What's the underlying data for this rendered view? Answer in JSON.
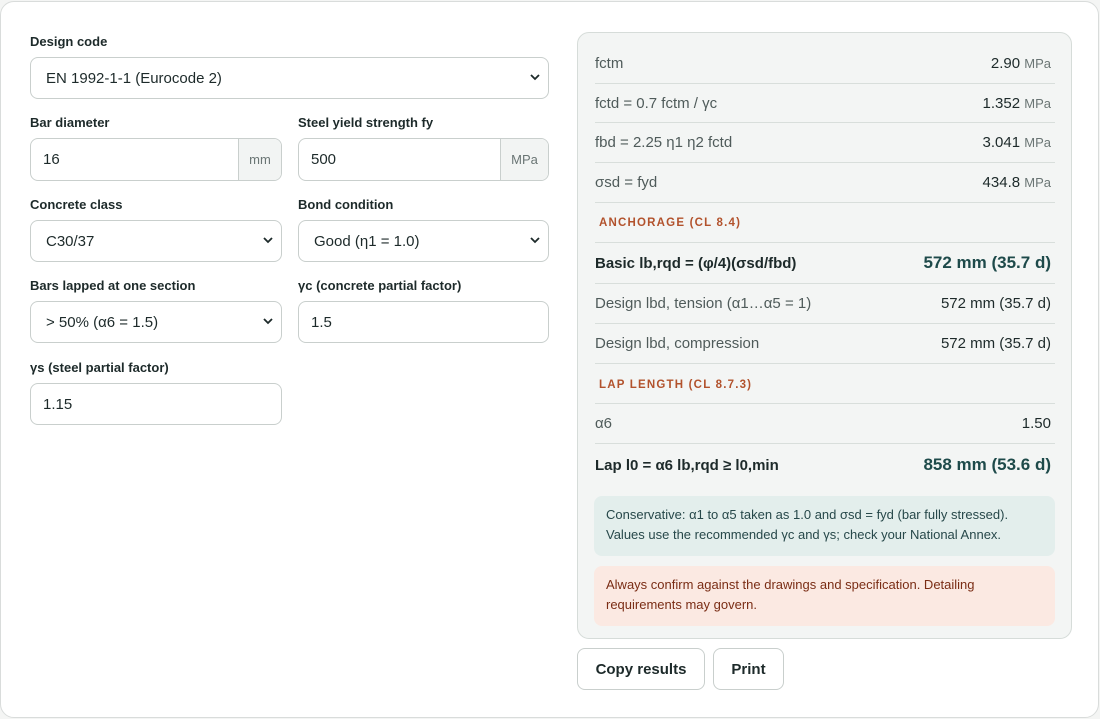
{
  "form": {
    "design_code": {
      "label": "Design code",
      "value": "EN 1992-1-1 (Eurocode 2)"
    },
    "bar_diameter": {
      "label": "Bar diameter",
      "value": "16",
      "unit": "mm"
    },
    "steel_yield": {
      "label": "Steel yield strength fy",
      "value": "500",
      "unit": "MPa"
    },
    "concrete_class": {
      "label": "Concrete class",
      "value": "C30/37"
    },
    "bond_condition": {
      "label": "Bond condition",
      "value": "Good (η1 = 1.0)"
    },
    "bars_lapped": {
      "label": "Bars lapped at one section",
      "value": "> 50% (α6 = 1.5)"
    },
    "gamma_c": {
      "label": "γc (concrete partial factor)",
      "value": "1.5"
    },
    "gamma_s": {
      "label": "γs (steel partial factor)",
      "value": "1.15"
    }
  },
  "results": {
    "rows_top": [
      {
        "key": "fctm",
        "value": "2.90",
        "unit": "MPa"
      },
      {
        "key": "fctd = 0.7 fctm / γc",
        "value": "1.352",
        "unit": "MPa"
      },
      {
        "key": "fbd = 2.25 η1 η2 fctd",
        "value": "3.041",
        "unit": "MPa"
      },
      {
        "key": "σsd = fyd",
        "value": "434.8",
        "unit": "MPa"
      }
    ],
    "anchorage_heading": "ANCHORAGE (CL 8.4)",
    "anchorage_rows": [
      {
        "key": "Basic lb,rqd = (φ/4)(σsd/fbd)",
        "value": "572 mm (35.7 d)"
      },
      {
        "key": "Design lbd, tension (α1…α5 = 1)",
        "value": "572 mm (35.7 d)"
      },
      {
        "key": "Design lbd, compression",
        "value": "572 mm (35.7 d)"
      }
    ],
    "lap_heading": "LAP LENGTH (CL 8.7.3)",
    "lap_rows": [
      {
        "key": "α6",
        "value": "1.50"
      },
      {
        "key": "Lap l0 = α6 lb,rqd ≥ l0,min",
        "value": "858 mm (53.6 d)"
      }
    ],
    "note_info": "Conservative: α1 to α5 taken as 1.0 and σsd = fyd (bar fully stressed). Values use the recommended γc and γs; check your National Annex.",
    "note_warn": "Always confirm against the drawings and specification. Detailing requirements may govern."
  },
  "actions": {
    "copy": "Copy results",
    "print": "Print"
  },
  "colors": {
    "accent_heading": "#b2522c",
    "strong_value": "#1e4a4a",
    "info_bg": "#e3eeec",
    "warn_bg": "#fbe9e2"
  }
}
